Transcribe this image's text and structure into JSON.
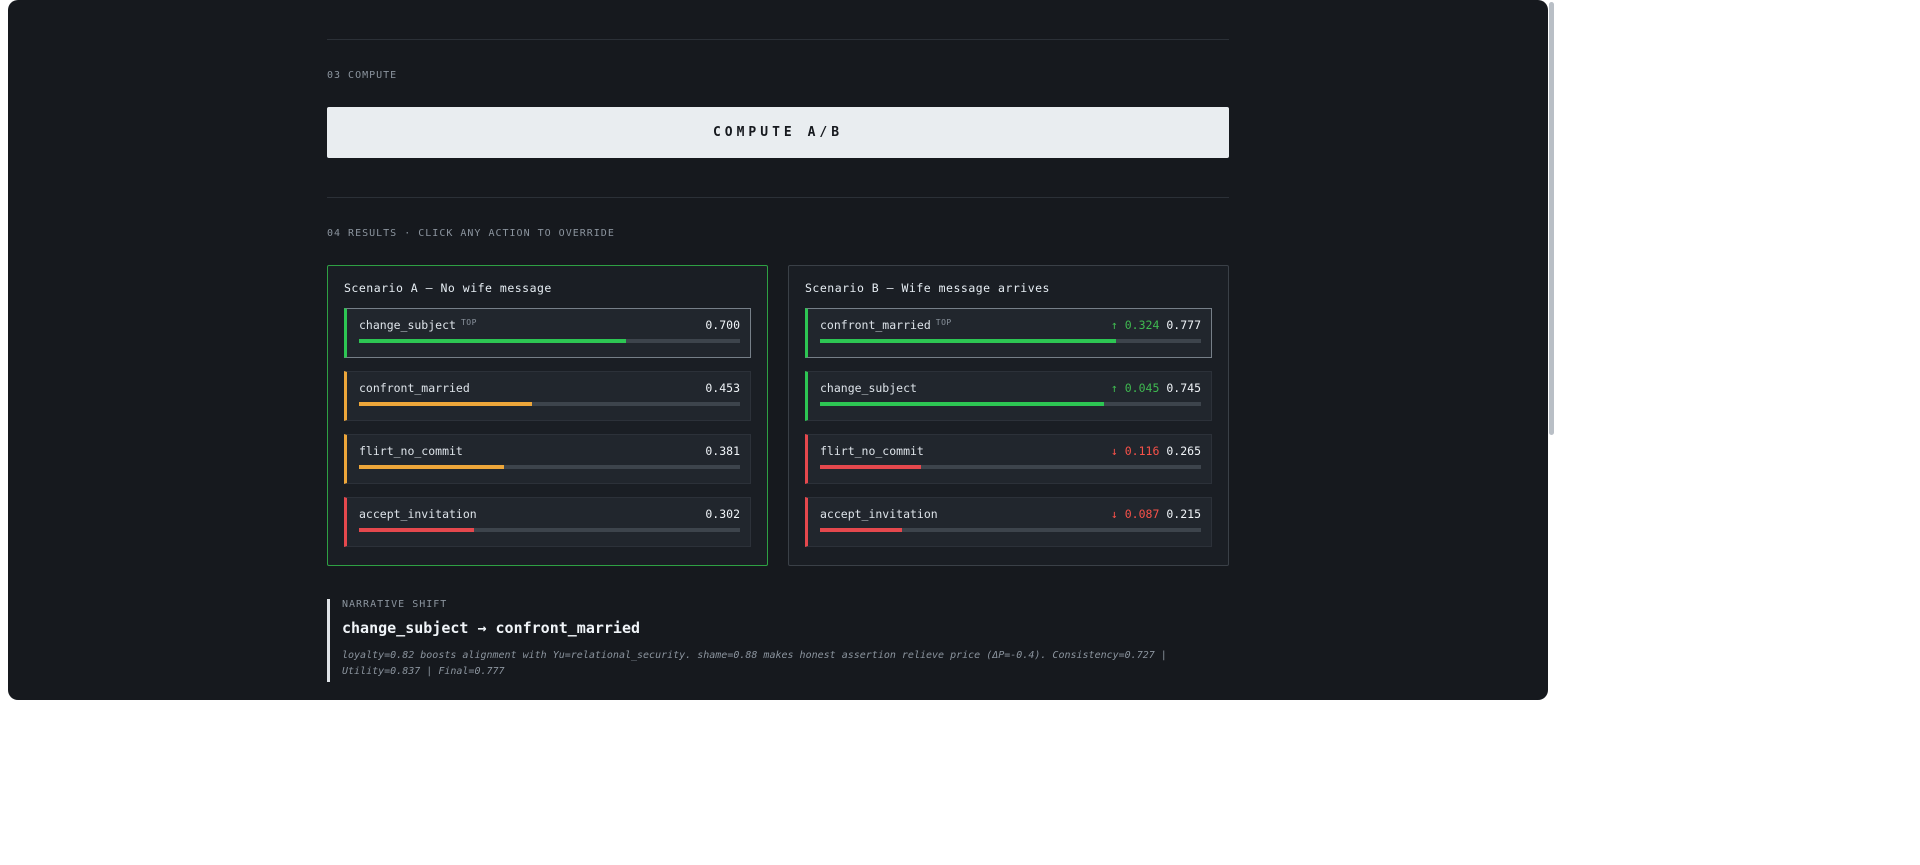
{
  "colors": {
    "app_bg": "#16191e",
    "button_bg": "#e9edf0",
    "panel_highlight_border": "#2ea043",
    "accent_green": "#2dc653",
    "accent_amber": "#eda63a",
    "accent_red": "#e5484d",
    "delta_up": "#3fb950",
    "delta_down": "#f85149"
  },
  "sections": {
    "compute": {
      "label": "03 COMPUTE",
      "button_label": "COMPUTE A/B"
    },
    "results": {
      "label": "04 RESULTS · CLICK ANY ACTION TO OVERRIDE"
    }
  },
  "scenarios": [
    {
      "title": "Scenario A — No wife message",
      "actions": [
        {
          "name": "change_subject",
          "badge": "TOP",
          "value": "0.700",
          "pct": 70.0,
          "color": "green"
        },
        {
          "name": "confront_married",
          "value": "0.453",
          "pct": 45.3,
          "color": "amber"
        },
        {
          "name": "flirt_no_commit",
          "value": "0.381",
          "pct": 38.1,
          "color": "amber"
        },
        {
          "name": "accept_invitation",
          "value": "0.302",
          "pct": 30.2,
          "color": "red"
        }
      ]
    },
    {
      "title": "Scenario B — Wife message arrives",
      "actions": [
        {
          "name": "confront_married",
          "badge": "TOP",
          "delta": "↑ 0.324",
          "delta_dir": "up",
          "value": "0.777",
          "pct": 77.7,
          "color": "green"
        },
        {
          "name": "change_subject",
          "delta": "↑ 0.045",
          "delta_dir": "up",
          "value": "0.745",
          "pct": 74.5,
          "color": "green"
        },
        {
          "name": "flirt_no_commit",
          "delta": "↓ 0.116",
          "delta_dir": "down",
          "value": "0.265",
          "pct": 26.5,
          "color": "red"
        },
        {
          "name": "accept_invitation",
          "delta": "↓ 0.087",
          "delta_dir": "down",
          "value": "0.215",
          "pct": 21.5,
          "color": "red"
        }
      ]
    }
  ],
  "narrative": {
    "label": "NARRATIVE SHIFT",
    "title": "change_subject → confront_married",
    "description": "loyalty=0.82 boosts alignment with Yu=relational_security. shame=0.88 makes honest assertion relieve price (ΔP=-0.4). Consistency=0.727 | Utility=0.837 | Final=0.777"
  }
}
